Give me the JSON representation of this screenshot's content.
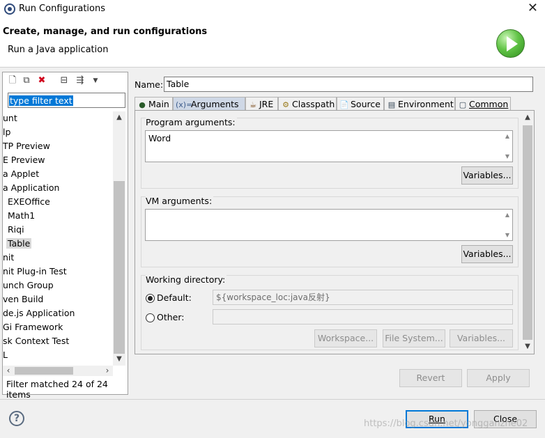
{
  "window": {
    "title": "Run Configurations",
    "close_glyph": "✕"
  },
  "banner": {
    "heading": "Create, manage, and run configurations",
    "subtitle": "Run a Java application"
  },
  "left": {
    "filter_placeholder": "type filter text",
    "items": [
      "unt",
      "lp",
      "TP Preview",
      "E Preview",
      "a Applet",
      "a Application",
      "EXEOffice",
      "Math1",
      "Riqi",
      "Table",
      "nit",
      "nit Plug-in Test",
      "unch Group",
      "ven Build",
      "de.js Application",
      "Gi Framework",
      "sk Context Test",
      "L"
    ],
    "selected_item": "Table",
    "filter_status": "Filter matched 24 of 24 items"
  },
  "right": {
    "name_label": "Name:",
    "name_value": "Table",
    "tabs": [
      {
        "label": "Main",
        "icon": "main-tab-icon",
        "glyph": "●"
      },
      {
        "label": "Arguments",
        "icon": "arguments-tab-icon",
        "glyph": "(x)="
      },
      {
        "label": "JRE",
        "icon": "jre-tab-icon",
        "glyph": "☕"
      },
      {
        "label": "Classpath",
        "icon": "classpath-tab-icon",
        "glyph": "⚙"
      },
      {
        "label": "Source",
        "icon": "source-tab-icon",
        "glyph": "📄"
      },
      {
        "label": "Environment",
        "icon": "environment-tab-icon",
        "glyph": "▤"
      },
      {
        "label": "Common",
        "icon": "common-tab-icon",
        "glyph": "▢"
      }
    ],
    "active_tab": "Arguments",
    "program_arguments": {
      "label": "Program arguments:",
      "value": "Word",
      "variables_label": "Variables..."
    },
    "vm_arguments": {
      "label": "VM arguments:",
      "value": "",
      "variables_label": "Variables..."
    },
    "working_directory": {
      "label": "Working directory:",
      "default_label": "Default:",
      "default_value": "${workspace_loc:java反射}",
      "other_label": "Other:",
      "other_value": "",
      "workspace_label": "Workspace...",
      "file_system_label": "File System...",
      "variables_label": "Variables..."
    },
    "revert_label": "Revert",
    "apply_label": "Apply"
  },
  "bottom": {
    "run_label": "Run",
    "close_label": "Close",
    "help_glyph": "?",
    "watermark": "https://blog.csdn.net/yongganzhe02"
  }
}
